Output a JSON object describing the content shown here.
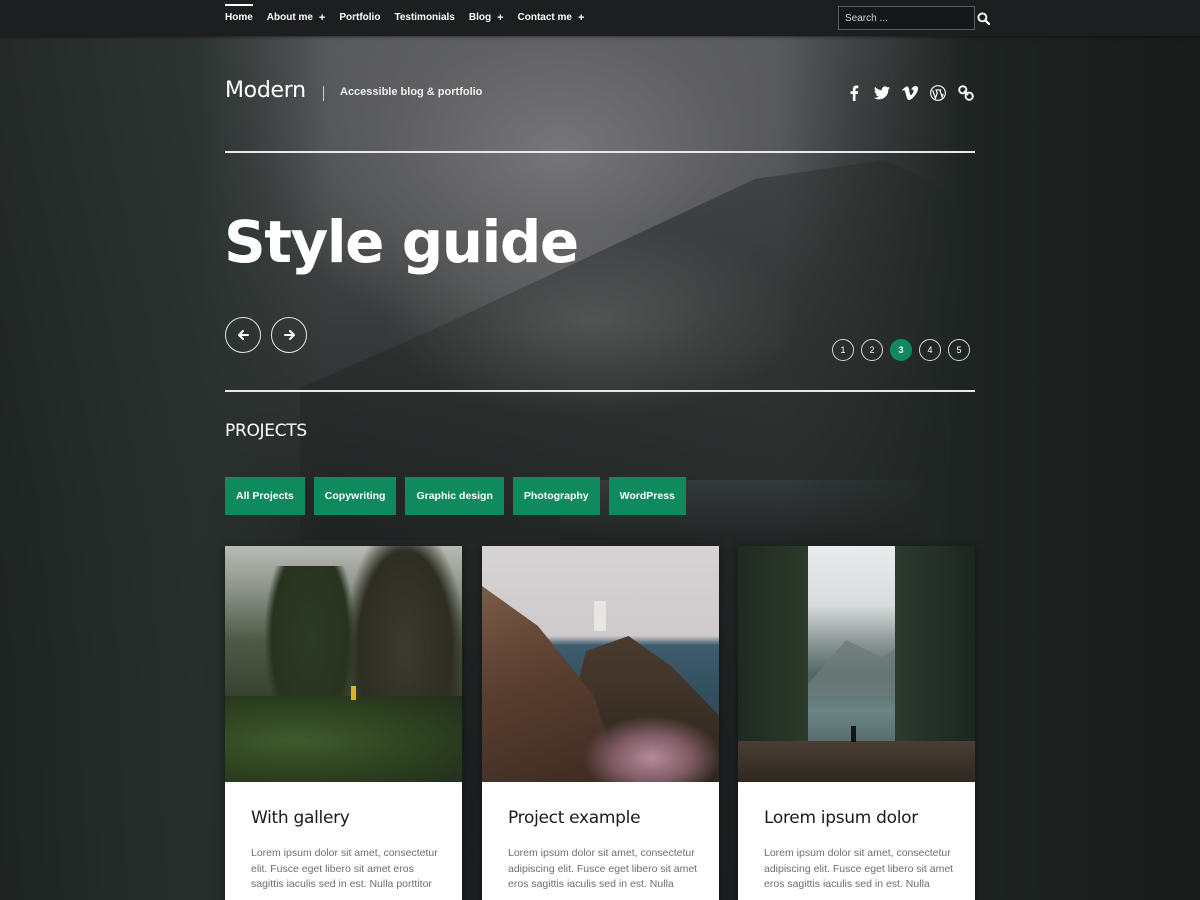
{
  "nav": {
    "items": [
      {
        "label": "Home",
        "active": true,
        "has_submenu": false
      },
      {
        "label": "About me",
        "active": false,
        "has_submenu": true
      },
      {
        "label": "Portfolio",
        "active": false,
        "has_submenu": false
      },
      {
        "label": "Testimonials",
        "active": false,
        "has_submenu": false
      },
      {
        "label": "Blog",
        "active": false,
        "has_submenu": true
      },
      {
        "label": "Contact me",
        "active": false,
        "has_submenu": true
      }
    ],
    "submenu_indicator": "+",
    "search": {
      "placeholder": "Search ...",
      "value": "",
      "icon": "search-icon"
    }
  },
  "header": {
    "site_title": "Modern",
    "tagline": "Accessible blog & portfolio",
    "social": [
      {
        "name": "facebook",
        "icon": "facebook-icon"
      },
      {
        "name": "twitter",
        "icon": "twitter-icon"
      },
      {
        "name": "vimeo",
        "icon": "vimeo-icon"
      },
      {
        "name": "wordpress",
        "icon": "wordpress-icon"
      },
      {
        "name": "link",
        "icon": "link-icon"
      }
    ]
  },
  "hero": {
    "title": "Style guide",
    "prev_icon": "arrow-left-icon",
    "next_icon": "arrow-right-icon",
    "pages": [
      "1",
      "2",
      "3",
      "4",
      "5"
    ],
    "current_page": 3
  },
  "projects": {
    "heading": "PROJECTS",
    "filters": [
      "All Projects",
      "Copywriting",
      "Graphic design",
      "Photography",
      "WordPress"
    ],
    "cards": [
      {
        "title": "With gallery",
        "excerpt": "Lorem ipsum dolor sit amet, consectetur elit. Fusce eget libero sit amet eros sagittis iaculis sed in est. Nulla porttitor"
      },
      {
        "title": "Project example",
        "excerpt": "Lorem ipsum dolor sit amet, consectetur adipiscing elit. Fusce eget libero sit amet eros sagittis iaculis sed in est. Nulla"
      },
      {
        "title": "Lorem ipsum dolor",
        "excerpt": "Lorem ipsum dolor sit amet, consectetur adipiscing elit. Fusce eget libero sit amet eros sagittis iaculis sed in est. Nulla"
      }
    ]
  },
  "colors": {
    "accent": "#0f8a5f",
    "topbar": "#1d1e1f",
    "background": "#1c1e1f",
    "card": "#ffffff",
    "card_text": "#6e6e6e"
  }
}
